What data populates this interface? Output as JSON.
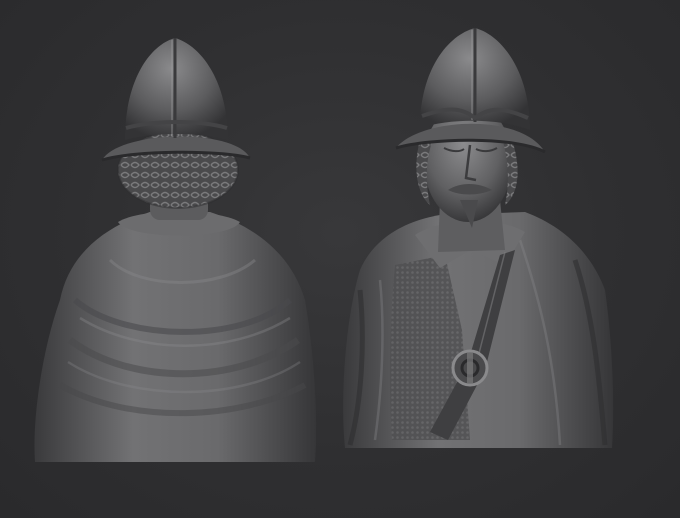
{
  "scene": {
    "background_color": "#2f2f31",
    "material_color": "#6a6a6c",
    "highlight_color": "#9a9a9c",
    "shadow_color": "#1c1c1e",
    "views": [
      {
        "id": "back",
        "icon": "sculpt-bust-back-view"
      },
      {
        "id": "front",
        "icon": "sculpt-bust-front-view"
      }
    ]
  }
}
